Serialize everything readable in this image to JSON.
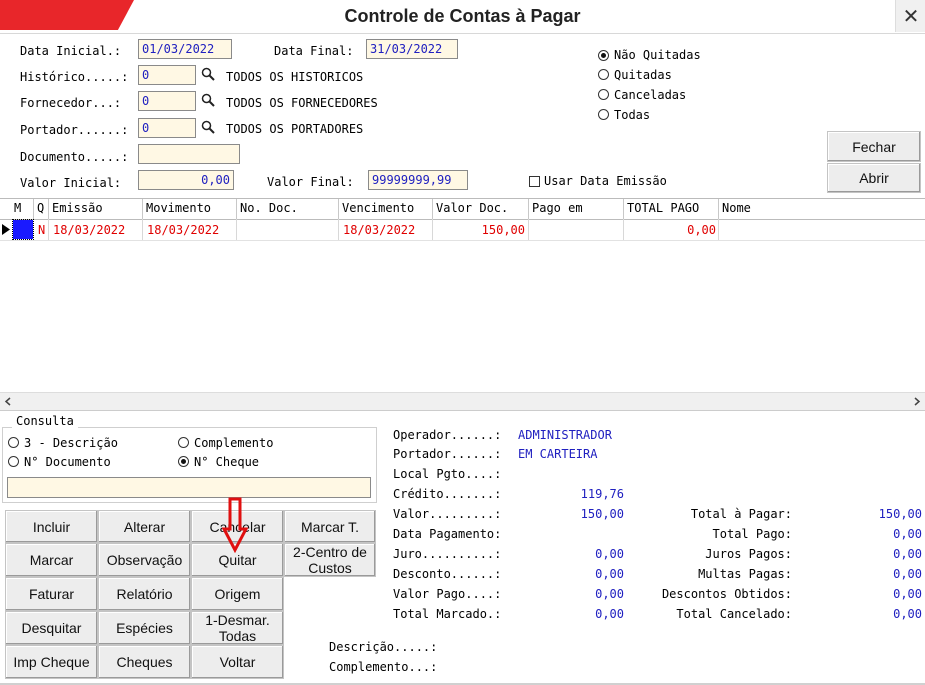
{
  "window": {
    "title": "Controle de Contas à Pagar"
  },
  "filters": {
    "data_inicial_label": "Data Inicial.:",
    "data_inicial": "01/03/2022",
    "data_final_label": "Data Final:",
    "data_final": "31/03/2022",
    "historico_label": "Histórico.....:",
    "historico_value": "0",
    "historico_desc": "TODOS OS HISTORICOS",
    "fornecedor_label": "Fornecedor...:",
    "fornecedor_value": "0",
    "fornecedor_desc": "TODOS OS FORNECEDORES",
    "portador_label": "Portador......:",
    "portador_value": "0",
    "portador_desc": "TODOS OS PORTADORES",
    "documento_label": "Documento.....:",
    "documento_value": "",
    "valor_inicial_label": "Valor Inicial:",
    "valor_inicial": "0,00",
    "valor_final_label": "Valor Final:",
    "valor_final": "99999999,99",
    "usar_data_emissao": "Usar Data Emissão"
  },
  "status_options": [
    "Não Quitadas",
    "Quitadas",
    "Canceladas",
    "Todas"
  ],
  "status_selected": "Não Quitadas",
  "top_buttons": {
    "fechar": "Fechar",
    "abrir": "Abrir"
  },
  "grid": {
    "columns": [
      "M",
      "Q",
      "Emissão",
      "Movimento",
      "No. Doc.",
      "Vencimento",
      "Valor Doc.",
      "Pago em",
      "TOTAL PAGO",
      "Nome"
    ],
    "rows": [
      {
        "q": "N",
        "emissao": "18/03/2022",
        "movimento": "18/03/2022",
        "no_doc": "",
        "vencimento": "18/03/2022",
        "valor_doc": "150,00",
        "pago_em": "",
        "total_pago": "0,00",
        "nome": ""
      }
    ]
  },
  "consulta": {
    "title": "Consulta",
    "options": [
      "3 - Descrição",
      "Complemento",
      "N° Documento",
      "N° Cheque"
    ],
    "selected": "N° Cheque",
    "search_value": ""
  },
  "buttons": [
    [
      "Incluir",
      "Alterar",
      "Cancelar",
      "Marcar T."
    ],
    [
      "Marcar",
      "Observação",
      "Quitar",
      "2-Centro de Custos"
    ],
    [
      "Faturar",
      "Relatório",
      "Origem"
    ],
    [
      "Desquitar",
      "Espécies",
      "1-Desmar. Todas"
    ],
    [
      "Imp Cheque",
      "Cheques",
      "Voltar"
    ]
  ],
  "info": {
    "operador_label": "Operador......:",
    "operador": "ADMINISTRADOR",
    "portador_label": "Portador......:",
    "portador": "EM CARTEIRA",
    "local_pgto_label": "Local Pgto....:",
    "credito_label": "Crédito.......:",
    "credito": "119,76",
    "valor_label": "Valor.........:",
    "valor": "150,00",
    "data_pagamento_label": "Data Pagamento:",
    "juro_label": "Juro..........:",
    "juro": "0,00",
    "desconto_label": "Desconto......:",
    "desconto": "0,00",
    "valor_pago_label": "Valor Pago....:",
    "valor_pago": "0,00",
    "total_marcado_label": "Total Marcado.:",
    "total_marcado": "0,00",
    "total_a_pagar_label": "Total à Pagar:",
    "total_a_pagar": "150,00",
    "total_pago_label": "Total Pago:",
    "total_pago": "0,00",
    "juros_pagos_label": "Juros Pagos:",
    "juros_pagos": "0,00",
    "multas_pagas_label": "Multas Pagas:",
    "multas_pagas": "0,00",
    "descontos_obtidos_label": "Descontos Obtidos:",
    "descontos_obtidos": "0,00",
    "total_cancelado_label": "Total Cancelado:",
    "total_cancelado": "0,00",
    "descricao_label": "Descrição.....:",
    "complemento_label": "Complemento...:"
  },
  "colors": {
    "accent": "#e8262a",
    "value_text": "#2020c0",
    "row_text": "#e00000",
    "field_bg": "#fff8e4"
  }
}
